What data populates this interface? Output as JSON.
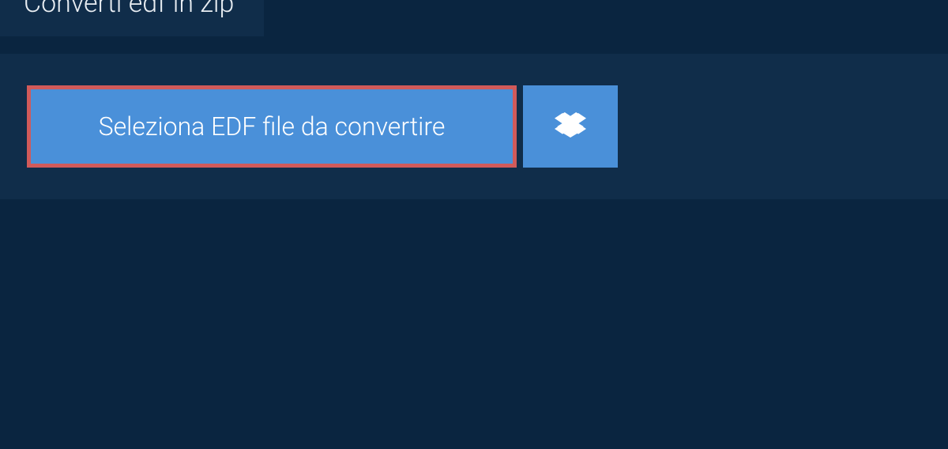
{
  "tab": {
    "label": "Converti edf in zip"
  },
  "main": {
    "select_button_label": "Seleziona EDF file da convertire"
  }
}
